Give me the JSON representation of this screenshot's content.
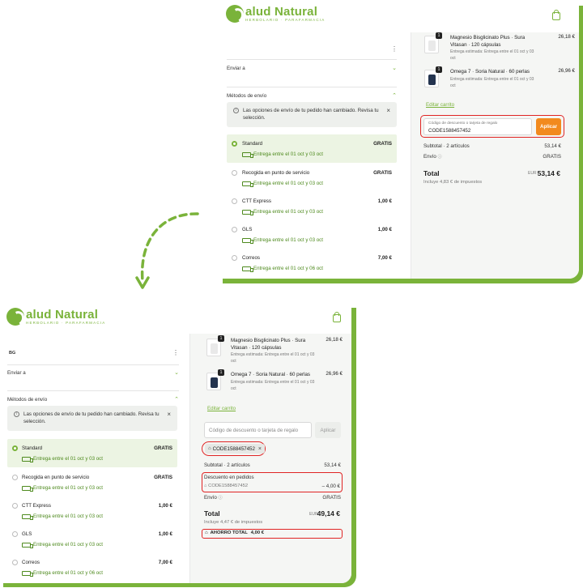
{
  "brand": {
    "name": "alud Natural",
    "tagline": "HERBOLARIO · PARAFARMACIA",
    "color": "#7ab33a"
  },
  "accent_orange": "#f28a1e",
  "highlight_red": "#e02424",
  "top": {
    "enviar_a": "Enviar a",
    "metodos": "Métodos de envío",
    "notice": "Las opciones de envío de tu pedido han cambiado. Revisa tu selección.",
    "shipping": [
      {
        "name": "Standard",
        "price": "GRATIS",
        "eta": "Entrega entre el 01 oct y 03 oct",
        "selected": true
      },
      {
        "name": "Recogida en punto de servicio",
        "price": "GRATIS",
        "eta": "Entrega entre el 01 oct y 03 oct"
      },
      {
        "name": "CTT Express",
        "price": "1,00 €",
        "eta": "Entrega entre el 01 oct y 03 oct"
      },
      {
        "name": "GLS",
        "price": "1,00 €",
        "eta": "Entrega entre el 01 oct y 03 oct"
      },
      {
        "name": "Correos",
        "price": "7,00 €",
        "eta": "Entrega entre el 01 oct y 06 oct"
      }
    ],
    "products": [
      {
        "qty": "1",
        "title": "Magnesio Bisglicinato Plus · Sura Vitasan · 120 cápsulas",
        "meta": "Entrega estimada: Entrega entre el 01 oct y 03 oct",
        "price": "26,18 €"
      },
      {
        "qty": "1",
        "title": "Omega 7 · Soria Natural · 60 perlas",
        "meta": "Entrega estimada: Entrega entre el 01 oct y 03 oct",
        "price": "26,96 €"
      }
    ],
    "edit_cart": "Editar carrito",
    "code_label": "Código de descuento o tarjeta de regalo",
    "code_value": "CODE1588457452",
    "apply": "Aplicar",
    "subtotal_label": "Subtotal · 2 artículos",
    "subtotal": "53,14 €",
    "envio_label": "Envío",
    "envio": "GRATIS",
    "total_label": "Total",
    "currency": "EUR",
    "total": "53,14 €",
    "taxes": "Incluye 4,83 € de impuestos"
  },
  "bottom": {
    "country": "BG",
    "enviar_a": "Enviar a",
    "metodos": "Métodos de envío",
    "notice": "Las opciones de envío de tu pedido han cambiado. Revisa tu selección.",
    "shipping": [
      {
        "name": "Standard",
        "price": "GRATIS",
        "eta": "Entrega entre el 01 oct y 03 oct",
        "selected": true
      },
      {
        "name": "Recogida en punto de servicio",
        "price": "GRATIS",
        "eta": "Entrega entre el 01 oct y 03 oct"
      },
      {
        "name": "CTT Express",
        "price": "1,00 €",
        "eta": "Entrega entre el 01 oct y 03 oct"
      },
      {
        "name": "GLS",
        "price": "1,00 €",
        "eta": "Entrega entre el 01 oct y 03 oct"
      },
      {
        "name": "Correos",
        "price": "7,00 €",
        "eta": "Entrega entre el 01 oct y 06 oct"
      }
    ],
    "products": [
      {
        "qty": "1",
        "title": "Magnesio Bisglicinato Plus · Sura Vitasan · 120 cápsulas",
        "meta": "Entrega estimada: Entrega entre el 01 oct y 03 oct",
        "price": "26,18 €"
      },
      {
        "qty": "1",
        "title": "Omega 7 · Soria Natural · 60 perlas",
        "meta": "Entrega estimada: Entrega entre el 01 oct y 03 oct",
        "price": "26,96 €"
      }
    ],
    "edit_cart": "Editar carrito",
    "code_placeholder": "Código de descuento o tarjeta de regalo",
    "apply": "Aplicar",
    "applied_code": "CODE1588457452",
    "subtotal_label": "Subtotal · 2 artículos",
    "subtotal": "53,14 €",
    "discount_label": "Descuento en pedidos",
    "discount_code": "CODE1588457452",
    "discount": "– 4,00 €",
    "envio_label": "Envío",
    "envio": "GRATIS",
    "total_label": "Total",
    "currency": "EUR",
    "total": "49,14 €",
    "taxes": "Incluye 4,47 € de impuestos",
    "savings_label": "AHORRO TOTAL",
    "savings": "4,00 €"
  }
}
